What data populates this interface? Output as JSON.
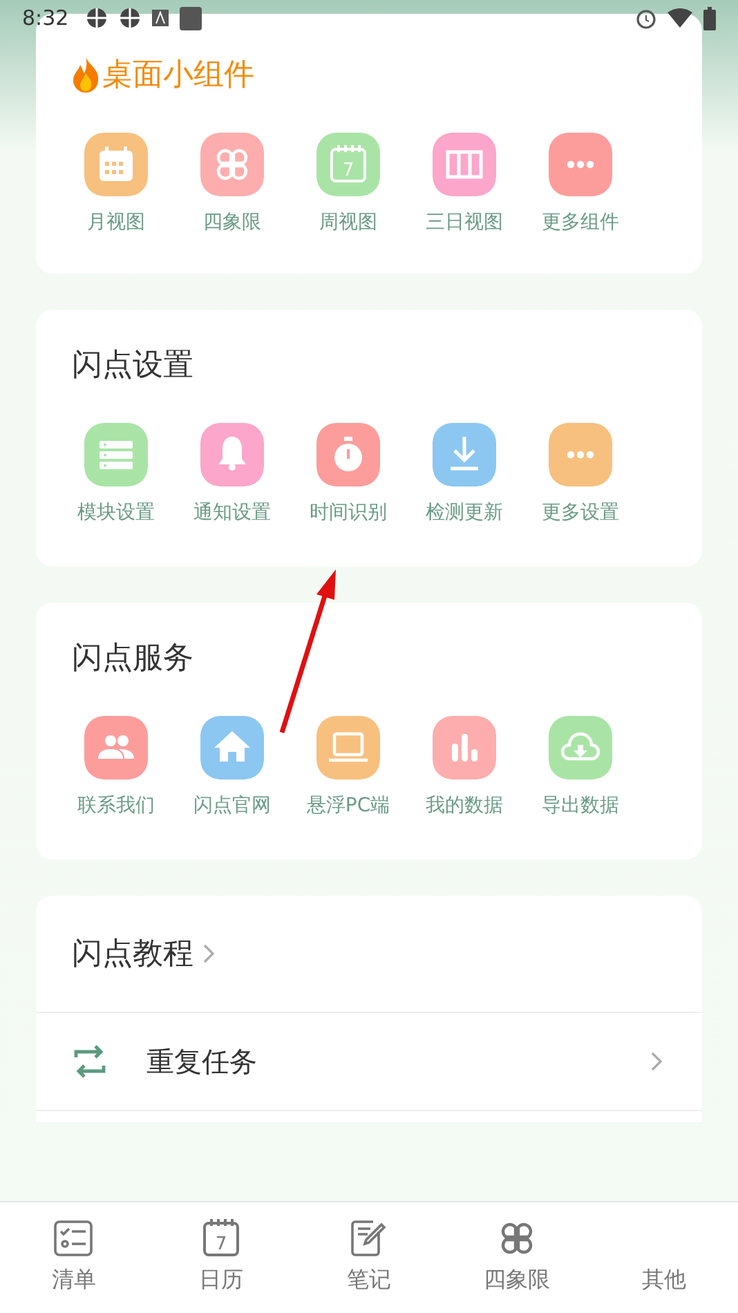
{
  "status_bar": {
    "time": "8:32"
  },
  "sections": [
    {
      "title": "桌面小组件",
      "kind": "featured",
      "items": [
        {
          "label": "月视图",
          "kind": "calendar",
          "color": "#f7c07e"
        },
        {
          "label": "四象限",
          "kind": "quad",
          "color": "#fdadad"
        },
        {
          "label": "周视图",
          "kind": "week",
          "icon_text": "7",
          "color": "#a9e4a6"
        },
        {
          "label": "三日视图",
          "kind": "columns",
          "color": "#fba6ca"
        },
        {
          "label": "更多组件",
          "kind": "more",
          "color": "#fc9d9c"
        }
      ]
    },
    {
      "title": "闪点设置",
      "kind": "plain",
      "items": [
        {
          "label": "模块设置",
          "kind": "list",
          "color": "#a9e4a6"
        },
        {
          "label": "通知设置",
          "kind": "bell",
          "color": "#fba6ca"
        },
        {
          "label": "时间识别",
          "kind": "timer",
          "color": "#fc9d9c"
        },
        {
          "label": "检测更新",
          "kind": "download",
          "color": "#8cc7f2"
        },
        {
          "label": "更多设置",
          "kind": "more",
          "color": "#f7c07e"
        }
      ]
    },
    {
      "title": "闪点服务",
      "kind": "plain",
      "items": [
        {
          "label": "联系我们",
          "kind": "people",
          "color": "#fc9d9c"
        },
        {
          "label": "闪点官网",
          "kind": "home",
          "color": "#8cc7f2"
        },
        {
          "label": "悬浮PC端",
          "kind": "laptop",
          "color": "#f7c07e"
        },
        {
          "label": "我的数据",
          "kind": "chart",
          "color": "#fdadad"
        },
        {
          "label": "导出数据",
          "kind": "cloud",
          "color": "#a9e4a6"
        }
      ]
    }
  ],
  "list": {
    "title": "闪点教程",
    "rows": [
      {
        "label": "重复任务",
        "kind": "repeat"
      }
    ]
  },
  "tab_bar": [
    {
      "label": "清单",
      "kind": "checklist"
    },
    {
      "label": "日历",
      "kind": "week",
      "icon_text": "7"
    },
    {
      "label": "笔记",
      "kind": "note"
    },
    {
      "label": "四象限",
      "kind": "quad"
    },
    {
      "label": "其他",
      "kind": "other"
    }
  ]
}
